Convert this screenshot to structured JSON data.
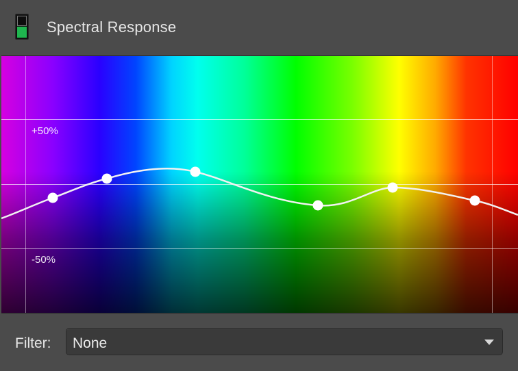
{
  "panel": {
    "title": "Spectral Response",
    "icon": "color-swatch-icon",
    "swatch_colors": {
      "top": "#0d0d0d",
      "bottom": "#1fb64f"
    }
  },
  "graph": {
    "plus_label": "+50%",
    "minus_label": "-50%"
  },
  "filter": {
    "label": "Filter:",
    "value": "None"
  }
}
